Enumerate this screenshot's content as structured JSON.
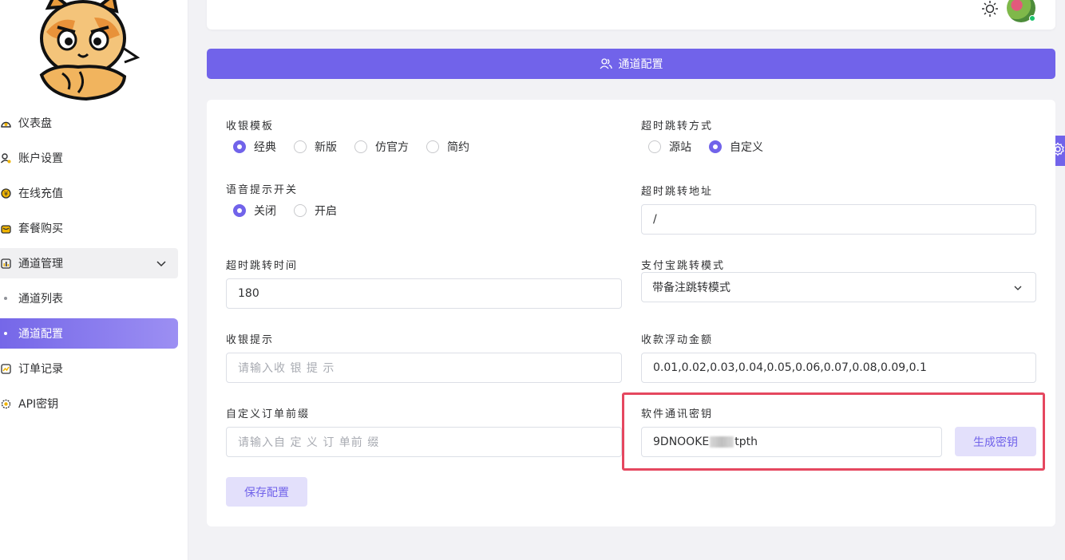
{
  "sidebar": {
    "items": [
      {
        "label": "仪表盘",
        "icon": "dashboard-icon"
      },
      {
        "label": "账户设置",
        "icon": "user-settings-icon"
      },
      {
        "label": "在线充值",
        "icon": "recharge-icon"
      },
      {
        "label": "套餐购买",
        "icon": "package-icon"
      },
      {
        "label": "通道管理",
        "icon": "channel-chart-icon"
      },
      {
        "label": "通道列表"
      },
      {
        "label": "通道配置"
      },
      {
        "label": "订单记录",
        "icon": "order-icon"
      },
      {
        "label": "API密钥",
        "icon": "api-key-icon"
      }
    ]
  },
  "banner": {
    "title": "通道配置"
  },
  "form": {
    "template": {
      "label": "收银模板",
      "options": [
        "经典",
        "新版",
        "仿官方",
        "简约"
      ],
      "selected": "经典"
    },
    "timeout_mode": {
      "label": "超时跳转方式",
      "options": [
        "源站",
        "自定义"
      ],
      "selected": "自定义"
    },
    "voice": {
      "label": "语音提示开关",
      "options": [
        "关闭",
        "开启"
      ],
      "selected": "关闭"
    },
    "timeout_url": {
      "label": "超时跳转地址",
      "value": "/"
    },
    "timeout_time": {
      "label": "超时跳转时间",
      "value": "180"
    },
    "alipay_mode": {
      "label": "支付宝跳转模式",
      "value": "带备注跳转模式"
    },
    "cashier_tip": {
      "label": "收银提示",
      "placeholder": "请输入收 银 提 示"
    },
    "float_amount": {
      "label": "收款浮动金额",
      "value": "0.01,0.02,0.03,0.04,0.05,0.06,0.07,0.08,0.09,0.1"
    },
    "order_prefix": {
      "label": "自定义订单前缀",
      "placeholder": "请输入自 定 义 订 单前 缀"
    },
    "secret_key": {
      "label": "软件通讯密钥",
      "value_start": "9DNOOKE",
      "value_end": "tpth"
    },
    "generate_button": "生成密钥",
    "save_button": "保存配置"
  },
  "colors": {
    "accent": "#7163ea",
    "highlight": "#e5475f",
    "status_online": "#18c36b"
  }
}
